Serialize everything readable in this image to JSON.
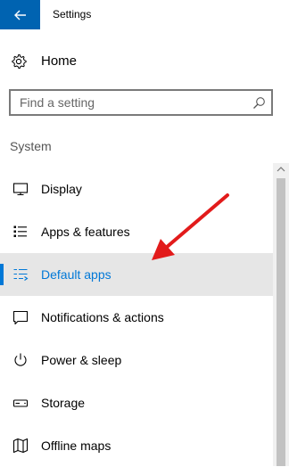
{
  "window": {
    "title": "Settings",
    "back_icon": "back-arrow-icon"
  },
  "home": {
    "label": "Home",
    "icon": "gear-icon"
  },
  "search": {
    "placeholder": "Find a setting",
    "value": "",
    "icon": "search-icon"
  },
  "sidebar": {
    "section_title": "System",
    "items": [
      {
        "label": "Display",
        "icon": "monitor-icon",
        "selected": false
      },
      {
        "label": "Apps & features",
        "icon": "apps-list-icon",
        "selected": false
      },
      {
        "label": "Default apps",
        "icon": "default-apps-icon",
        "selected": true
      },
      {
        "label": "Notifications & actions",
        "icon": "notification-icon",
        "selected": false
      },
      {
        "label": "Power & sleep",
        "icon": "power-icon",
        "selected": false
      },
      {
        "label": "Storage",
        "icon": "storage-icon",
        "selected": false
      },
      {
        "label": "Offline maps",
        "icon": "map-icon",
        "selected": false
      }
    ]
  },
  "colors": {
    "accent": "#0078d7",
    "title_bar_button": "#0063b1",
    "selected_background": "#e6e6e6",
    "annotation_arrow": "#e21b1b"
  }
}
